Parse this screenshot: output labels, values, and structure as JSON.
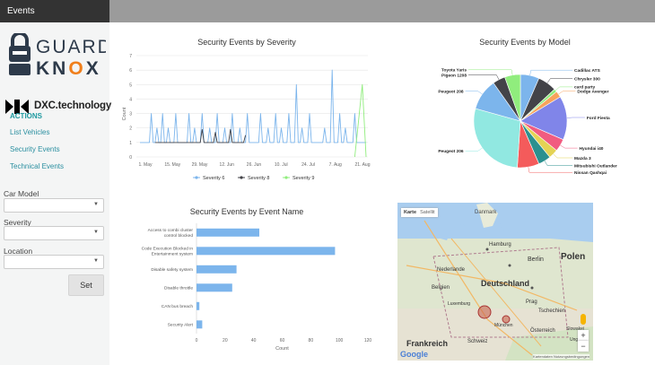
{
  "app": {
    "title": "Events"
  },
  "logos": {
    "guardknox_top": "GUARD",
    "guardknox_bottom": "KNOX",
    "dxc": "DXC.technology"
  },
  "sidebar": {
    "actions_heading": "ACTIONS",
    "links": [
      "List Vehicles",
      "Security Events",
      "Technical Events"
    ],
    "filters": [
      {
        "label": "Car Model",
        "value": ""
      },
      {
        "label": "Severity",
        "value": ""
      },
      {
        "label": "Location",
        "value": ""
      }
    ],
    "set_label": "Set"
  },
  "colors": {
    "accent": "#1f9aa0",
    "series_6": "#7cb5ec",
    "series_8": "#434348",
    "series_9": "#90ed7d",
    "orange": "#f07f1b"
  },
  "charts": [
    {
      "type": "line",
      "title": "Security Events by Severity",
      "ylabel": "Count",
      "ylim": [
        0,
        7
      ],
      "yticks": [
        "0",
        "1",
        "2",
        "3",
        "4",
        "5",
        "6",
        "7"
      ],
      "xticks": [
        "1. May",
        "15. May",
        "29. May",
        "12. Jun",
        "26. Jun",
        "10. Jul",
        "24. Jul",
        "7. Aug",
        "21. Aug"
      ],
      "x_range": [
        "2017-04-28",
        "2017-08-25"
      ],
      "series": [
        {
          "name": "Severity 6",
          "peaks": [
            [
              3,
              1
            ],
            [
              6,
              3
            ],
            [
              9,
              2
            ],
            [
              12,
              3
            ],
            [
              15,
              2
            ],
            [
              19,
              3
            ],
            [
              22,
              1
            ],
            [
              26,
              3
            ],
            [
              29,
              2
            ],
            [
              33,
              3
            ],
            [
              37,
              2
            ],
            [
              41,
              3
            ],
            [
              45,
              2
            ],
            [
              49,
              3
            ],
            [
              53,
              2
            ],
            [
              57,
              3
            ],
            [
              60,
              1
            ],
            [
              64,
              3
            ],
            [
              68,
              2
            ],
            [
              72,
              3
            ],
            [
              75,
              2
            ],
            [
              79,
              3
            ],
            [
              83,
              5
            ],
            [
              86,
              2
            ],
            [
              90,
              3
            ],
            [
              94,
              1
            ],
            [
              98,
              2
            ],
            [
              102,
              6
            ],
            [
              106,
              3
            ],
            [
              109,
              2
            ],
            [
              114,
              3
            ]
          ]
        },
        {
          "name": "Severity 8",
          "peaks": [
            [
              8,
              1
            ],
            [
              11,
              1
            ],
            [
              33,
              1.9
            ],
            [
              40,
              1.7
            ],
            [
              48,
              1.9
            ],
            [
              56,
              1.5
            ]
          ]
        },
        {
          "name": "Severity 9",
          "peaks": [
            [
              118,
              5
            ]
          ]
        }
      ]
    },
    {
      "type": "pie",
      "title": "Security Events by Model",
      "slices": [
        {
          "label": "Cadillac ATS",
          "value": 6,
          "color": "#7cb5ec"
        },
        {
          "label": "Chrysler 300",
          "value": 6,
          "color": "#434348"
        },
        {
          "label": "card party",
          "value": 1,
          "color": "#90ed7d"
        },
        {
          "label": "Dodge Avenger",
          "value": 2,
          "color": "#f7a35c"
        },
        {
          "label": "Ford Fiesta",
          "value": 14,
          "color": "#8085e9"
        },
        {
          "label": "Hyundai i40",
          "value": 4,
          "color": "#f15c80"
        },
        {
          "label": "Mazda 3",
          "value": 3,
          "color": "#e4d354"
        },
        {
          "label": "Mitsubishi Outlander",
          "value": 4,
          "color": "#2b908f"
        },
        {
          "label": "Nissan Qashqai",
          "value": 7,
          "color": "#f45b5b"
        },
        {
          "label": "Peugeot 206",
          "value": 26,
          "color": "#91e8e1"
        },
        {
          "label": "Peugeot 208",
          "value": 10,
          "color": "#7cb5ec"
        },
        {
          "label": "Pigeon 1208",
          "value": 4,
          "color": "#434348"
        },
        {
          "label": "Toyota Yaris",
          "value": 5,
          "color": "#90ed7d"
        }
      ]
    },
    {
      "type": "bar",
      "title": "Security Events by Event Name",
      "xlabel": "Count",
      "xlim": [
        0,
        120
      ],
      "xticks": [
        "0",
        "20",
        "40",
        "60",
        "80",
        "100",
        "120"
      ],
      "categories": [
        "Access to combi cluster control blocked",
        "Code Execution Blocked in Entertainment system",
        "Disable safety system",
        "Disable throttle",
        "CAN bus breach",
        "Security Alert"
      ],
      "values": [
        44,
        97,
        28,
        25,
        2,
        4
      ]
    }
  ],
  "map": {
    "tabs": [
      "Karte",
      "Satellit"
    ],
    "labels": [
      "Danmark",
      "Hamburg",
      "Berlin",
      "Nederlande",
      "Polen",
      "Deutschland",
      "Belgien",
      "Luxemburg",
      "Prag",
      "Tschechien",
      "Frankreich",
      "München",
      "Österreich",
      "Schweiz",
      "Slowakei",
      "Ung"
    ],
    "zoom_in": "+",
    "zoom_out": "−",
    "google": "Google",
    "attribution": "Kartendaten   Nutzungsbedingungen"
  }
}
